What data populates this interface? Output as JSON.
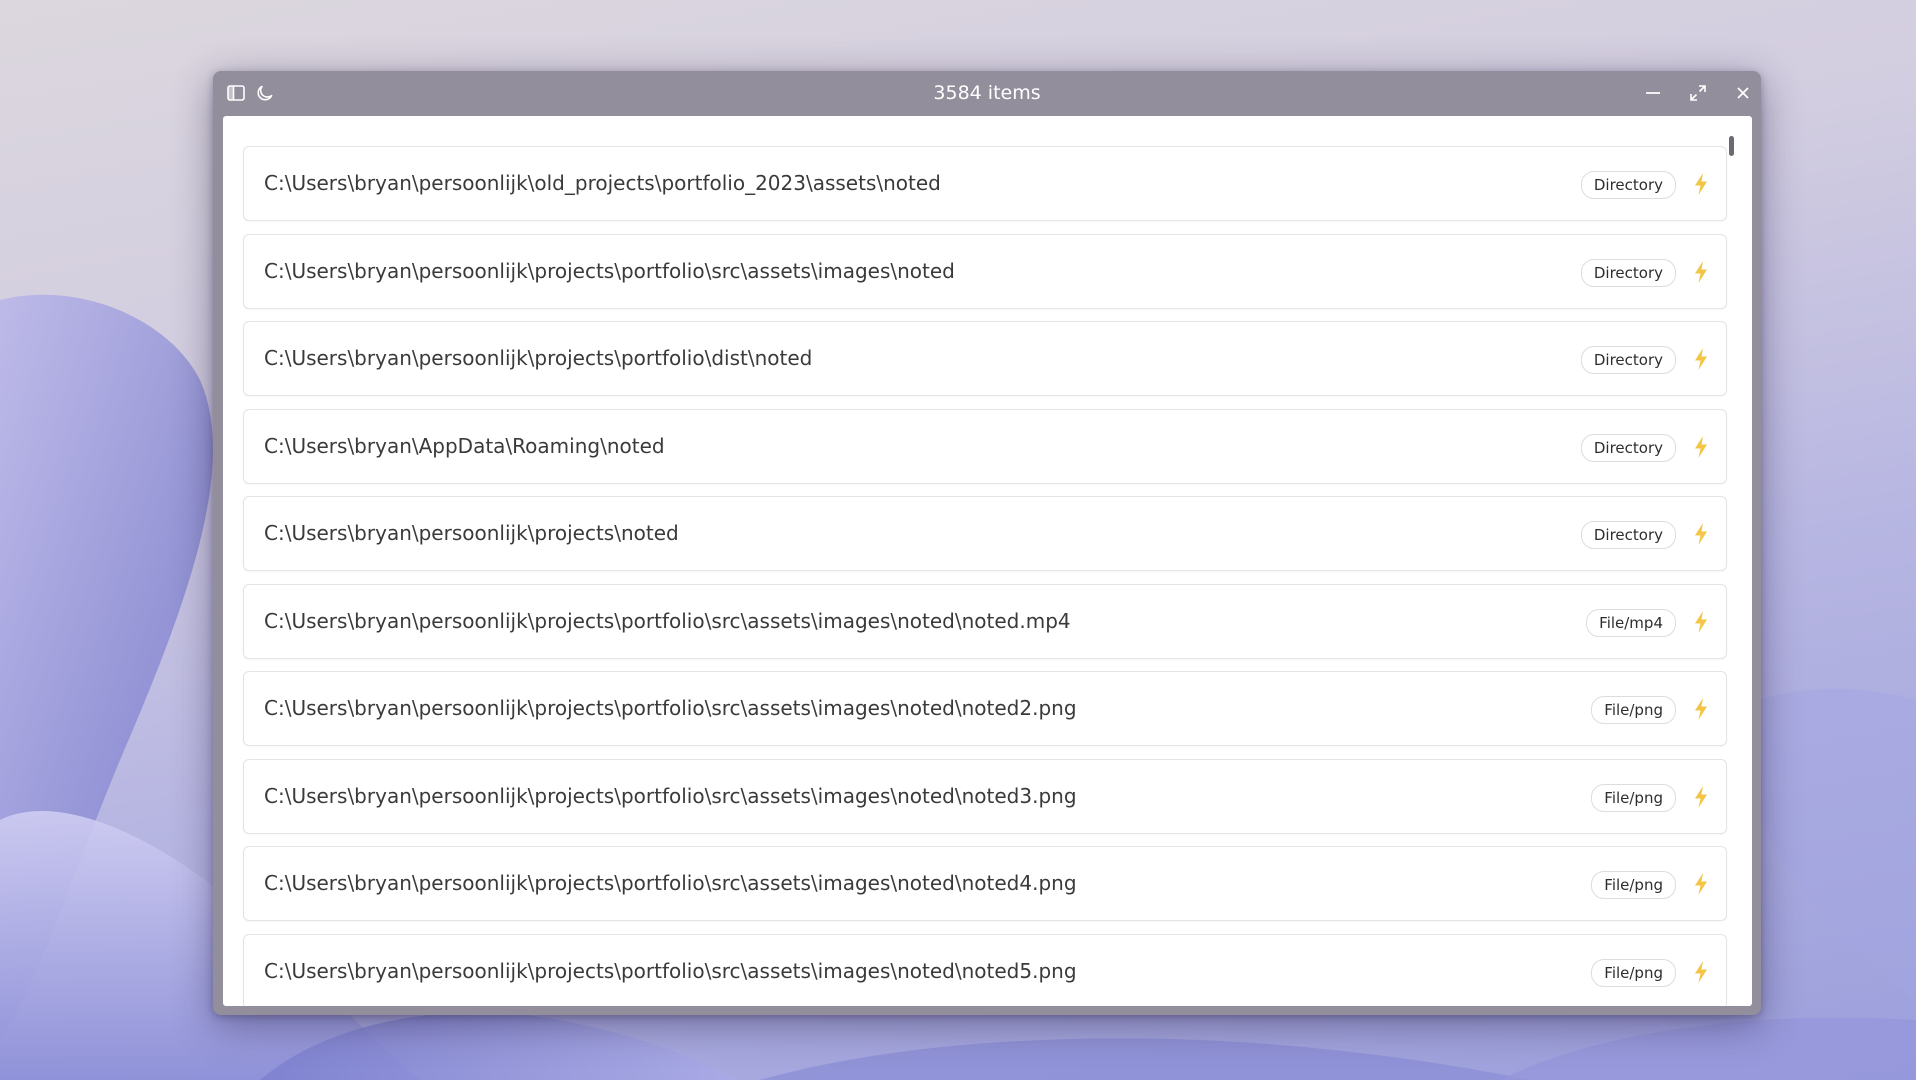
{
  "window": {
    "title": "3584 items",
    "accent": "#938e9c"
  },
  "toolbar": {
    "sidebar_icon": "sidebar-toggle-icon",
    "theme_icon": "moon-icon",
    "minimize_icon": "minimize-icon",
    "maximize_icon": "maximize-icon",
    "close_icon": "close-icon"
  },
  "colors": {
    "bolt": "#f3c546",
    "badge_border": "#dcdce2"
  },
  "items": [
    {
      "path": "C:\\Users\\bryan\\persoonlijk\\old_projects\\portfolio_2023\\assets\\noted",
      "type": "Directory"
    },
    {
      "path": "C:\\Users\\bryan\\persoonlijk\\projects\\portfolio\\src\\assets\\images\\noted",
      "type": "Directory"
    },
    {
      "path": "C:\\Users\\bryan\\persoonlijk\\projects\\portfolio\\dist\\noted",
      "type": "Directory"
    },
    {
      "path": "C:\\Users\\bryan\\AppData\\Roaming\\noted",
      "type": "Directory"
    },
    {
      "path": "C:\\Users\\bryan\\persoonlijk\\projects\\noted",
      "type": "Directory"
    },
    {
      "path": "C:\\Users\\bryan\\persoonlijk\\projects\\portfolio\\src\\assets\\images\\noted\\noted.mp4",
      "type": "File/mp4"
    },
    {
      "path": "C:\\Users\\bryan\\persoonlijk\\projects\\portfolio\\src\\assets\\images\\noted\\noted2.png",
      "type": "File/png"
    },
    {
      "path": "C:\\Users\\bryan\\persoonlijk\\projects\\portfolio\\src\\assets\\images\\noted\\noted3.png",
      "type": "File/png"
    },
    {
      "path": "C:\\Users\\bryan\\persoonlijk\\projects\\portfolio\\src\\assets\\images\\noted\\noted4.png",
      "type": "File/png"
    },
    {
      "path": "C:\\Users\\bryan\\persoonlijk\\projects\\portfolio\\src\\assets\\images\\noted\\noted5.png",
      "type": "File/png"
    }
  ]
}
